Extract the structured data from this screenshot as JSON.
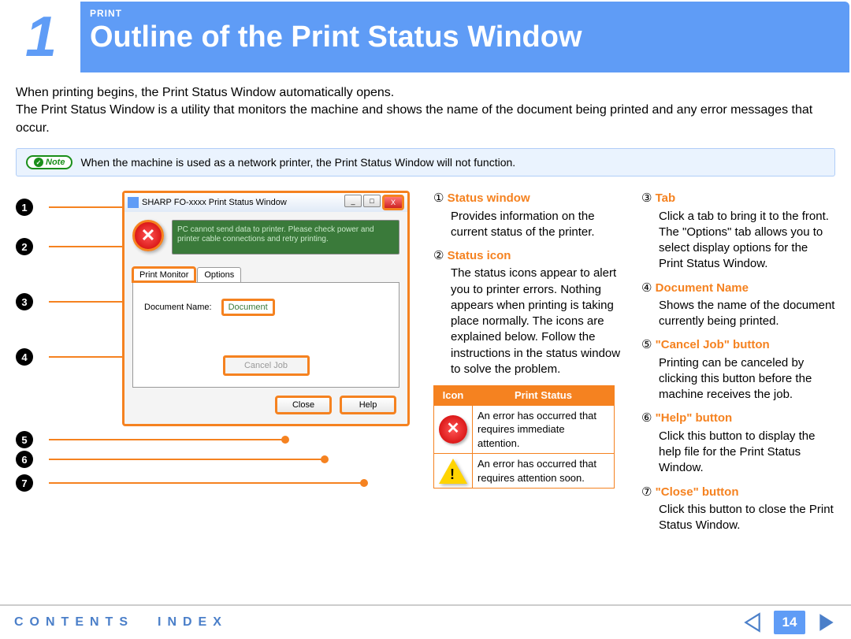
{
  "header": {
    "chapter_number": "1",
    "section_label": "PRINT",
    "title": "Outline of the Print Status Window"
  },
  "intro": {
    "p1": "When printing begins, the Print Status Window automatically opens.",
    "p2": "The Print Status Window is a utility that monitors the machine and shows the name of the document being printed and any error messages that occur."
  },
  "note": {
    "badge": "Note",
    "text": "When the machine is used as a network printer, the Print Status Window will not function."
  },
  "window_ui": {
    "title": "SHARP FO-xxxx Print Status Window",
    "close_x": "X",
    "error_msg": "PC cannot send data to printer. Please check power and printer cable connections and retry printing.",
    "tab_print_monitor": "Print Monitor",
    "tab_options": "Options",
    "doc_name_label": "Document Name:",
    "doc_name_value": "Document",
    "cancel_job_btn": "Cancel Job",
    "close_btn": "Close",
    "help_btn": "Help"
  },
  "callouts": [
    "1",
    "2",
    "3",
    "4",
    "5",
    "6",
    "7"
  ],
  "explanations": {
    "c1": {
      "num": "①",
      "title": "Status window",
      "body": "Provides information on the current status of the printer."
    },
    "c2": {
      "num": "②",
      "title": "Status icon",
      "body": "The status icons appear to alert you to printer errors. Nothing appears when printing is taking place normally. The icons are explained below. Follow the instructions in the status window to solve the problem."
    },
    "c3": {
      "num": "③",
      "title": "Tab",
      "body": "Click a tab to bring it to the front. The \"Options\" tab allows you to select display options for the Print Status Window."
    },
    "c4": {
      "num": "④",
      "title": "Document Name",
      "body": "Shows the name of the document currently being printed."
    },
    "c5": {
      "num": "⑤",
      "title": "\"Cancel Job\" button",
      "body": "Printing can be canceled by clicking this button before the machine receives the job."
    },
    "c6": {
      "num": "⑥",
      "title": "\"Help\" button",
      "body": "Click this button to display the help file for the Print Status Window."
    },
    "c7": {
      "num": "⑦",
      "title": "\"Close\" button",
      "body": "Click this button to close the Print Status Window."
    }
  },
  "icon_table": {
    "h_icon": "Icon",
    "h_status": "Print Status",
    "row1": "An error has occurred that requires immediate attention.",
    "row2": "An error has occurred that requires attention soon."
  },
  "footer": {
    "contents": "CONTENTS",
    "index": "INDEX",
    "page": "14"
  }
}
